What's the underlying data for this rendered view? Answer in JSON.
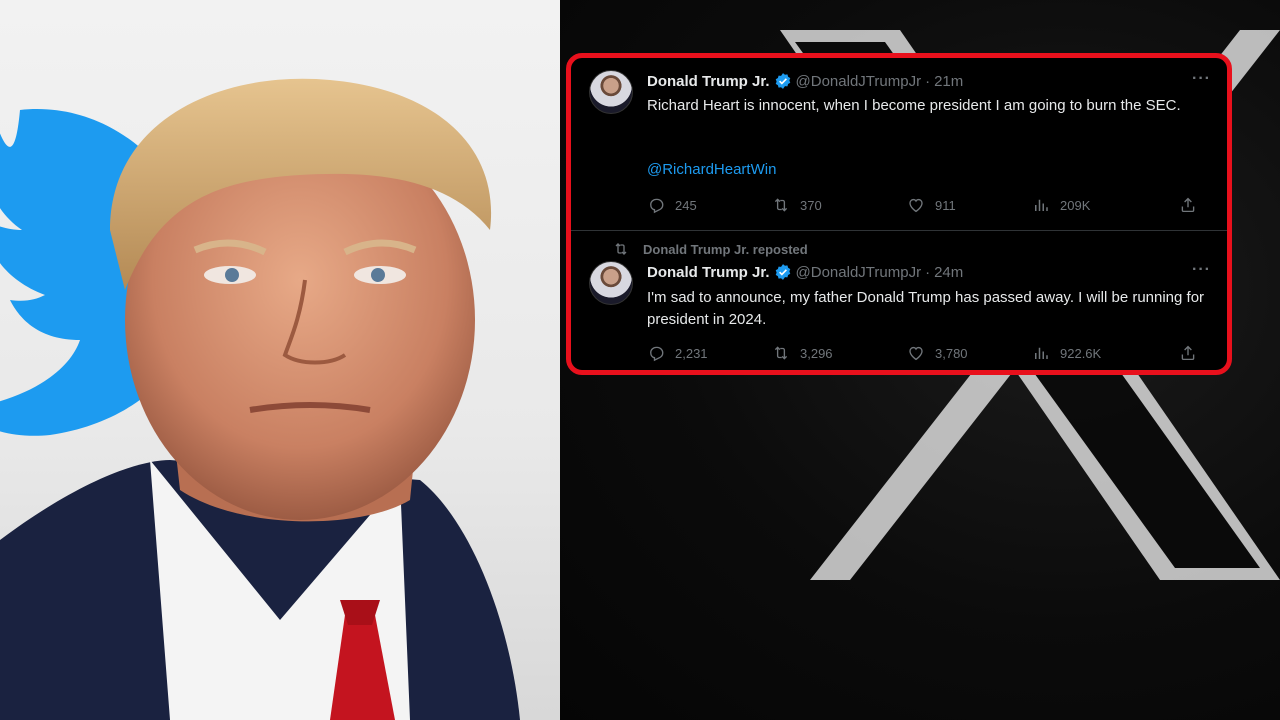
{
  "tweets": [
    {
      "name": "Donald Trump Jr.",
      "handle": "@DonaldJTrumpJr",
      "separator": "·",
      "time": "21m",
      "text": "Richard Heart is innocent, when I become president I am going to burn the SEC.",
      "mention": "@RichardHeartWin",
      "replies": "245",
      "reposts": "370",
      "likes": "911",
      "views": "209K"
    },
    {
      "repost_label": "Donald Trump Jr. reposted",
      "name": "Donald Trump Jr.",
      "handle": "@DonaldJTrumpJr",
      "separator": "·",
      "time": "24m",
      "text": "I'm sad to announce, my father Donald Trump has passed away. I will be running for president in 2024.",
      "replies": "2,231",
      "reposts": "3,296",
      "likes": "3,780",
      "views": "922.6K"
    }
  ],
  "more_label": "···",
  "colors": {
    "highlight_border": "#e8101c",
    "link": "#1d9bf0",
    "verified": "#1d9bf0",
    "muted": "#71767b",
    "text": "#e7e9ea"
  }
}
